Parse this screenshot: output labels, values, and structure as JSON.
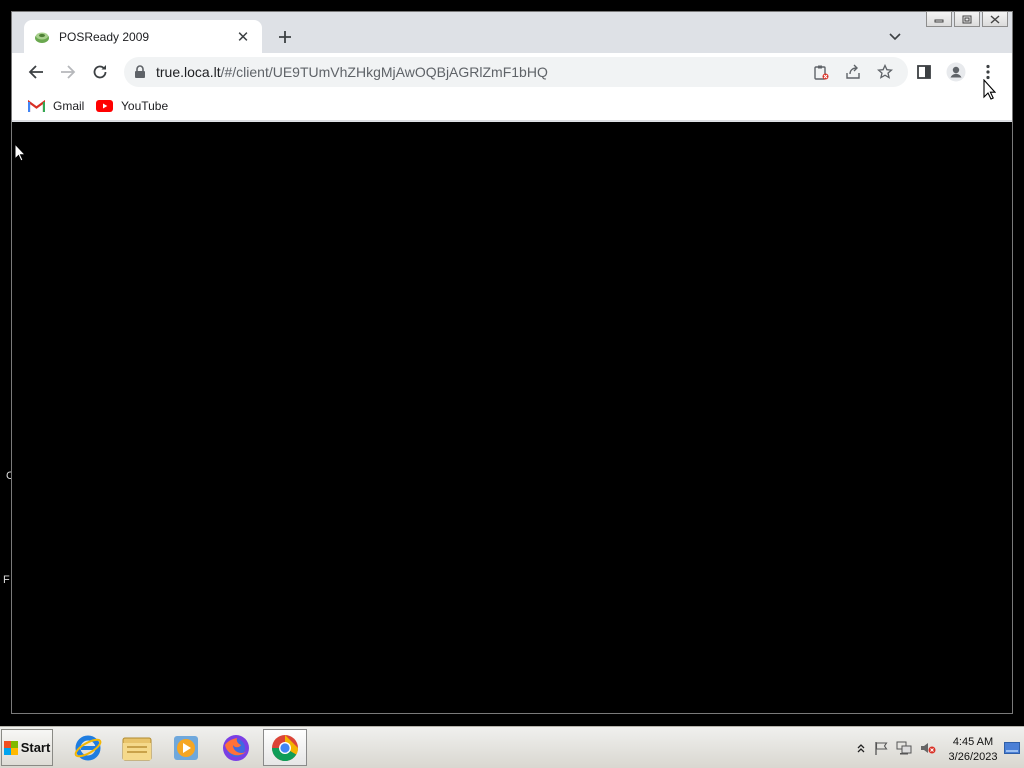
{
  "desktop": {
    "edge_glyphs": [
      "C",
      "F"
    ]
  },
  "browser": {
    "tab": {
      "title": "POSReady 2009"
    },
    "address_bar": {
      "host": "true.loca.lt",
      "path": "/#/client/UE9TUmVhZHkgMjAwOQBjAGRlZmF1bHQ"
    },
    "bookmarks": [
      {
        "label": "Gmail",
        "icon": "gmail-icon"
      },
      {
        "label": "YouTube",
        "icon": "youtube-icon"
      }
    ],
    "colors": {
      "tab_strip": "#dee1e6",
      "toolbar": "#ffffff",
      "content": "#000000",
      "omnibox": "#f1f3f4"
    }
  },
  "taskbar": {
    "start_label": "Start",
    "apps": [
      "internet-explorer-icon",
      "file-explorer-icon",
      "media-player-icon",
      "firefox-icon",
      "chrome-icon"
    ],
    "clock": {
      "time": "4:45 AM",
      "date": "3/26/2023"
    }
  }
}
